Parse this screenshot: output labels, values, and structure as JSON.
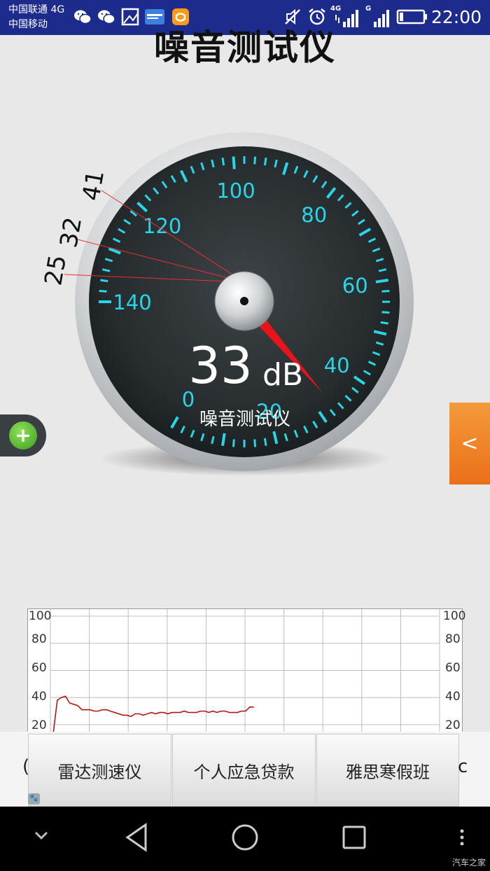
{
  "status_bar": {
    "carrier_1": "中国联通 4G",
    "carrier_2": "中国移动",
    "time": "22:00",
    "left_icons": [
      "wechat-icon",
      "wechat-icon",
      "image-icon",
      "app-badge-icon",
      "didi-icon"
    ],
    "right_icons": [
      "mute-icon",
      "alarm-icon",
      "signal-4g-icon",
      "signal-g-icon",
      "battery-icon"
    ],
    "signal_label_1": "4G",
    "signal_label_2": "G"
  },
  "page": {
    "title": "噪音测试仪"
  },
  "gauge": {
    "reading": "33",
    "unit": "dB",
    "label": "噪音测试仪",
    "scale_labels": [
      "0",
      "20",
      "40",
      "60",
      "80",
      "100",
      "120",
      "140"
    ],
    "needle_value": 33,
    "peak_marks": [
      "41",
      "32",
      "25"
    ],
    "accent_color": "#29d6e8",
    "needle_color": "#e8141c"
  },
  "buttons": {
    "add_symbol": "+",
    "side_tab_symbol": "<"
  },
  "history_chart": {
    "y_ticks": [
      "100",
      "80",
      "60",
      "40",
      "20"
    ],
    "line_color": "#b01818",
    "values": [
      10,
      38,
      40,
      41,
      36,
      35,
      34,
      31,
      31,
      31,
      30,
      30,
      31,
      31,
      30,
      29,
      28,
      27,
      27,
      26,
      28,
      28,
      27,
      28,
      29,
      28,
      29,
      29,
      28,
      29,
      29,
      29,
      30,
      29,
      29,
      29,
      30,
      30,
      29,
      30,
      29,
      30,
      30,
      29,
      29,
      29,
      30,
      30,
      33,
      33
    ]
  },
  "ads": {
    "items": [
      "雷达测速仪",
      "个人应急贷款",
      "雅思寒假班"
    ],
    "edge_left": "(",
    "edge_right": "c",
    "logo_text": "🐾"
  },
  "nav": {
    "icons": [
      "collapse-icon",
      "back-icon",
      "home-icon",
      "recents-icon",
      "menu-icon"
    ]
  },
  "watermark": "汽车之家"
}
